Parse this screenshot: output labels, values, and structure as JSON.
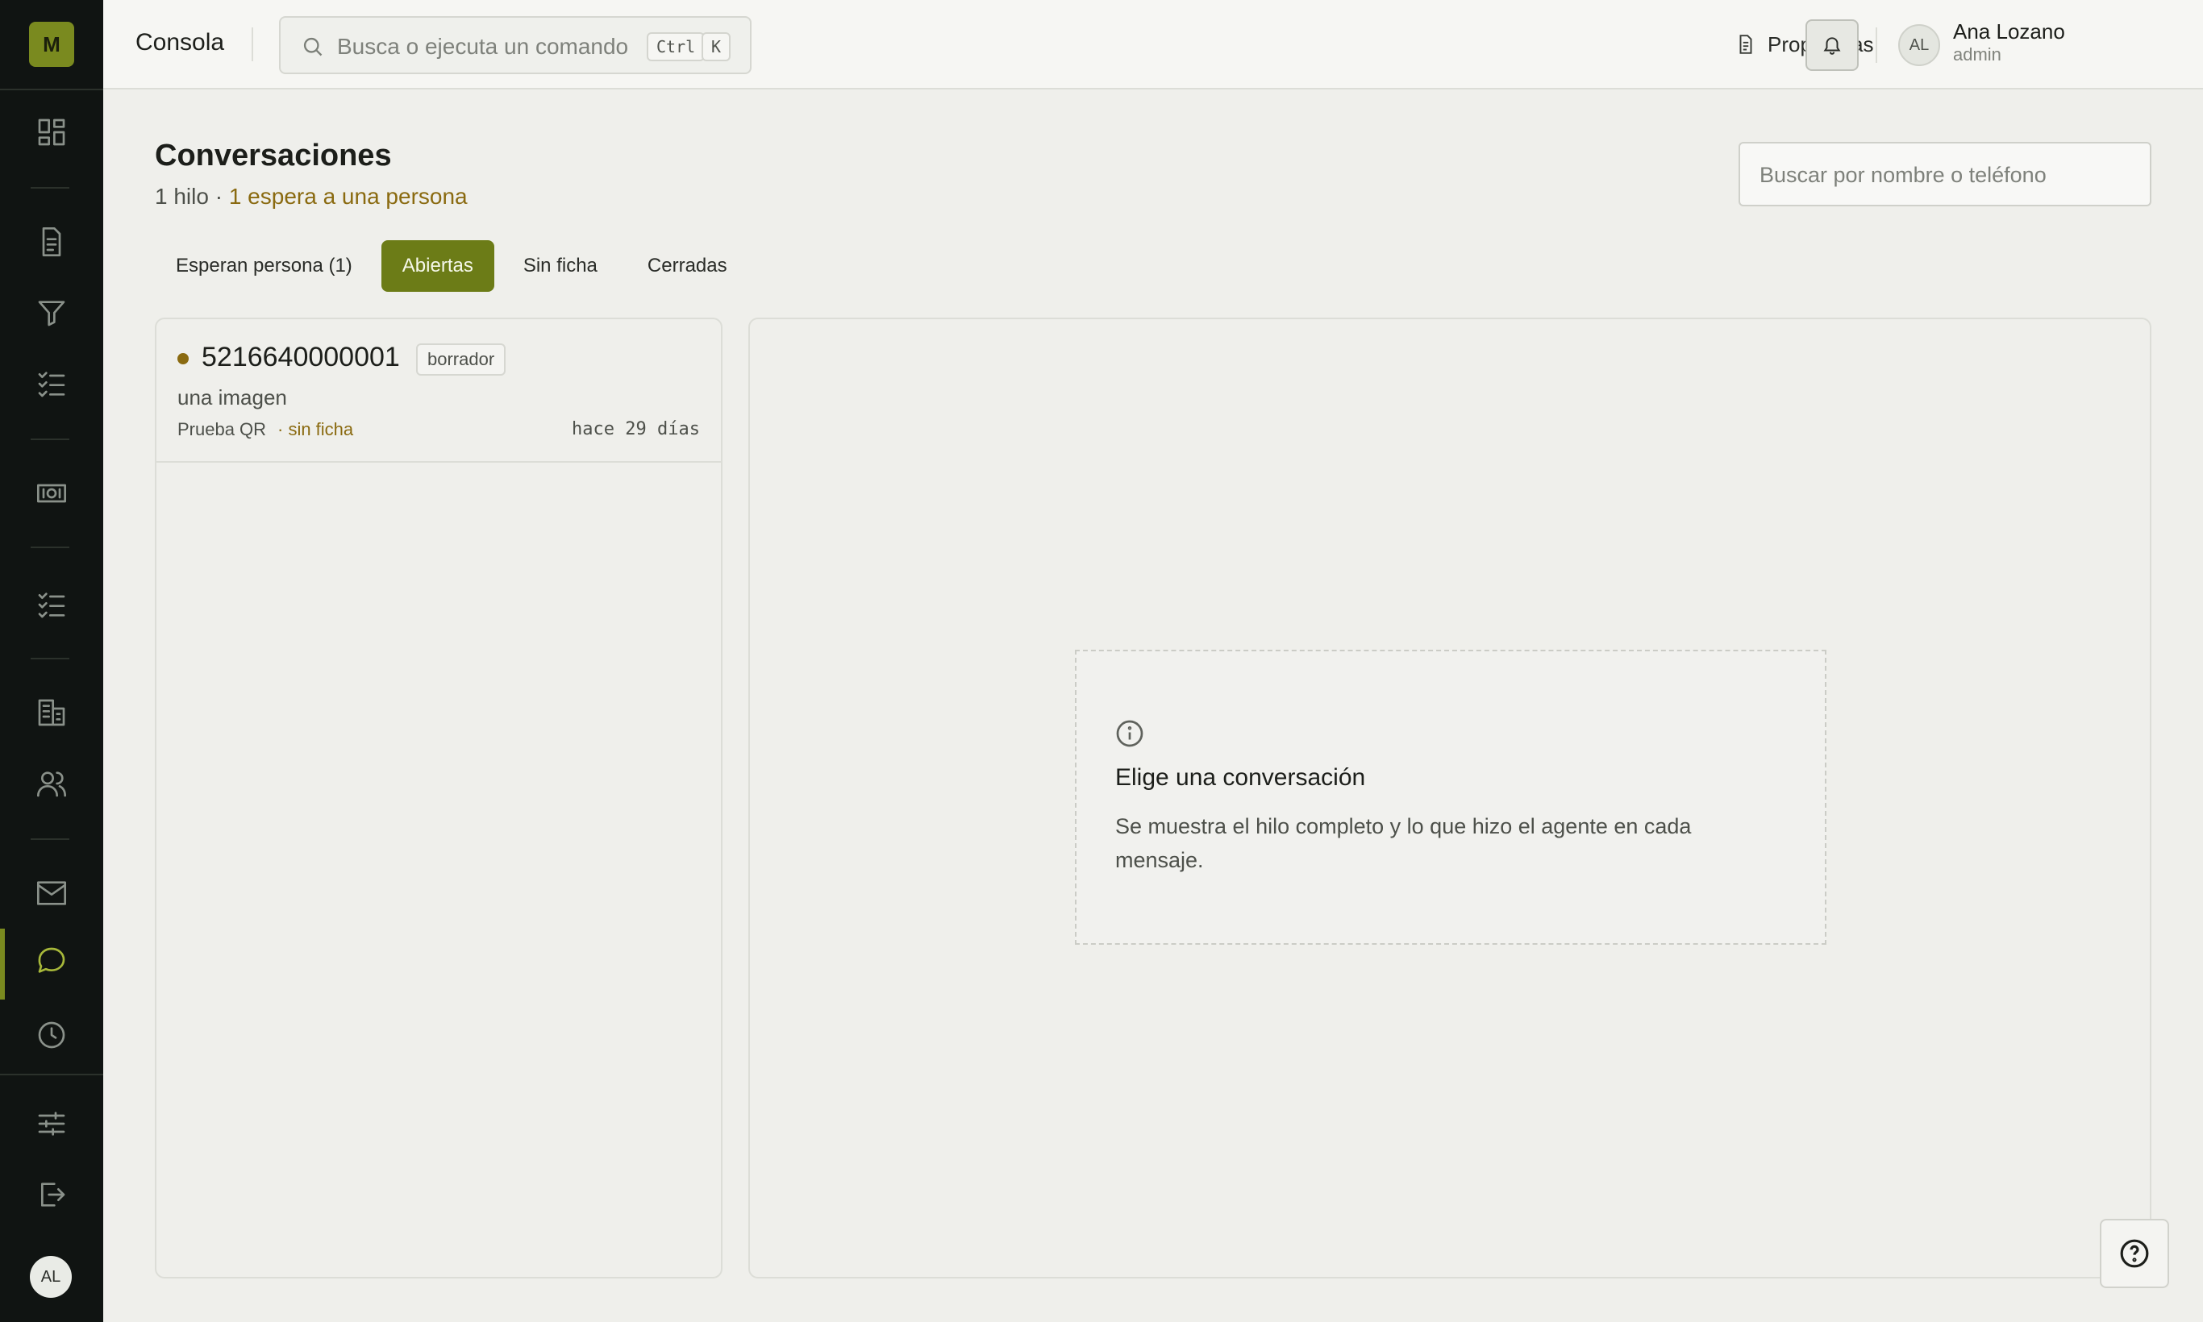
{
  "brand": {
    "logo_letter": "M"
  },
  "sidebar": {
    "items": [
      {
        "name": "dashboard",
        "icon": "dashboard-icon"
      },
      {
        "name": "documents",
        "icon": "document-icon"
      },
      {
        "name": "filters",
        "icon": "filter-icon"
      },
      {
        "name": "tasks",
        "icon": "checklist-icon"
      },
      {
        "name": "payments",
        "icon": "banknote-icon"
      },
      {
        "name": "lists",
        "icon": "checklist-icon"
      },
      {
        "name": "companies",
        "icon": "building-icon"
      },
      {
        "name": "users",
        "icon": "users-icon"
      },
      {
        "name": "mail",
        "icon": "mail-icon"
      },
      {
        "name": "conversations",
        "icon": "chat-bubble-icon",
        "active": true
      },
      {
        "name": "history",
        "icon": "clock-icon"
      },
      {
        "name": "settings",
        "icon": "sliders-icon"
      },
      {
        "name": "logout",
        "icon": "logout-icon"
      }
    ],
    "avatar_initials": "AL",
    "accent": "#7a8a1f"
  },
  "topbar": {
    "title": "Consola",
    "command_placeholder": "Busca o ejecuta un comando",
    "kbd_ctrl": "Ctrl",
    "kbd_k": "K",
    "proposals_label": "Propuestas",
    "user": {
      "initials": "AL",
      "name": "Ana Lozano",
      "role": "admin"
    }
  },
  "main": {
    "title": "Conversaciones",
    "subtitle_count": "1 hilo · ",
    "subtitle_waiting": "1 espera a una persona",
    "search_placeholder": "Buscar por nombre o teléfono",
    "tabs": [
      {
        "label": "Esperan persona (1)",
        "active": false
      },
      {
        "label": "Abiertas",
        "active": true
      },
      {
        "label": "Sin ficha",
        "active": false
      },
      {
        "label": "Cerradas",
        "active": false
      }
    ],
    "conversations": [
      {
        "phone": "5216640000001",
        "badge": "borrador",
        "snippet": "una imagen",
        "source": "Prueba QR",
        "flag": "· sin ficha",
        "time": "hace 29 días"
      }
    ],
    "empty_state": {
      "icon": "info-icon",
      "title": "Elige una conversación",
      "description": "Se muestra el hilo completo y lo que hizo el agente en cada mensaje."
    }
  },
  "colors": {
    "accent": "#6c7c17",
    "warning": "#8a6a10",
    "sidebar_bg": "#101412"
  }
}
